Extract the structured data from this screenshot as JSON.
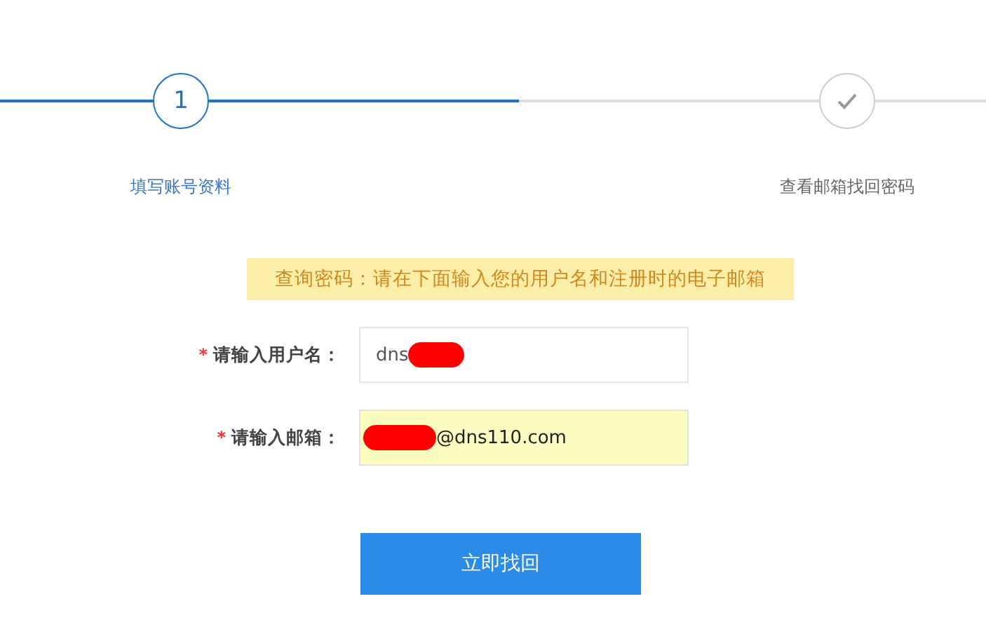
{
  "progress": {
    "level": 0.527
  },
  "steps": [
    {
      "marker": "1",
      "kind": "number",
      "active": true,
      "label": "填写账号资料"
    },
    {
      "kind": "check",
      "active": false,
      "label": "查看邮箱找回密码"
    }
  ],
  "notice": "查询密码：请在下面输入您的用户名和注册时的电子邮箱",
  "fields": [
    {
      "required_mark": "*",
      "label": "请输入用户名：",
      "value": "dns",
      "autofilled": false,
      "redacted": true,
      "redaction_first": false
    },
    {
      "required_mark": "*",
      "label": "请输入邮箱：",
      "value": "@dns110.com",
      "autofilled": true,
      "redacted": true,
      "redaction_first": true
    }
  ],
  "submit": "立即找回"
}
